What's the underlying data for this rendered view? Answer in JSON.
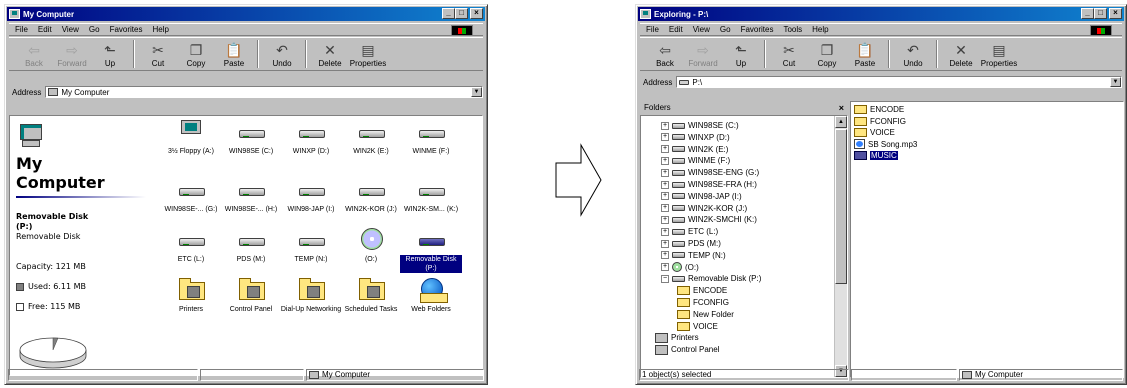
{
  "mycomputer": {
    "title": "My Computer",
    "menu": [
      "File",
      "Edit",
      "View",
      "Go",
      "Favorites",
      "Help"
    ],
    "toolbar": [
      {
        "label": "Back",
        "icon": "back-arrow-icon",
        "glyph": "⇦",
        "disabled": true
      },
      {
        "label": "Forward",
        "icon": "forward-arrow-icon",
        "glyph": "⇨",
        "disabled": true
      },
      {
        "label": "Up",
        "icon": "up-folder-icon",
        "glyph": "⬑",
        "disabled": false
      },
      {
        "label": "Cut",
        "icon": "scissors-icon",
        "glyph": "✂",
        "disabled": false
      },
      {
        "label": "Copy",
        "icon": "copy-icon",
        "glyph": "❐",
        "disabled": false
      },
      {
        "label": "Paste",
        "icon": "paste-icon",
        "glyph": "📋",
        "disabled": false
      },
      {
        "label": "Undo",
        "icon": "undo-icon",
        "glyph": "↶",
        "disabled": false
      },
      {
        "label": "Delete",
        "icon": "delete-x-icon",
        "glyph": "✕",
        "disabled": false
      },
      {
        "label": "Properties",
        "icon": "properties-icon",
        "glyph": "▤",
        "disabled": false
      }
    ],
    "address_label": "Address",
    "address_value": "My Computer",
    "heading": "My Computer",
    "selected_title": "Removable Disk (P:)",
    "selected_type": "Removable Disk",
    "capacity": "Capacity: 121 MB",
    "used": "Used: 6.11 MB",
    "free": "Free: 115 MB",
    "icons": [
      {
        "label": "3½ Floppy (A:)",
        "kind": "floppy"
      },
      {
        "label": "WIN98SE (C:)",
        "kind": "drive"
      },
      {
        "label": "WINXP (D:)",
        "kind": "drive"
      },
      {
        "label": "WIN2K (E:)",
        "kind": "drive"
      },
      {
        "label": "WINME (F:)",
        "kind": "drive"
      },
      {
        "label": "WIN98SE-... (G:)",
        "kind": "drive"
      },
      {
        "label": "WIN98SE-... (H:)",
        "kind": "drive"
      },
      {
        "label": "WIN98-JAP (I:)",
        "kind": "drive"
      },
      {
        "label": "WIN2K-KOR (J:)",
        "kind": "drive"
      },
      {
        "label": "WIN2K-SM... (K:)",
        "kind": "drive"
      },
      {
        "label": "ETC (L:)",
        "kind": "drive"
      },
      {
        "label": "PDS (M:)",
        "kind": "drive"
      },
      {
        "label": "TEMP (N:)",
        "kind": "drive"
      },
      {
        "label": "(O:)",
        "kind": "cd"
      },
      {
        "label": "Removable Disk (P:)",
        "kind": "removable",
        "selected": true
      },
      {
        "label": "Printers",
        "kind": "folder"
      },
      {
        "label": "Control Panel",
        "kind": "folder"
      },
      {
        "label": "Dial-Up Networking",
        "kind": "folder"
      },
      {
        "label": "Scheduled Tasks",
        "kind": "folder"
      },
      {
        "label": "Web Folders",
        "kind": "globe"
      }
    ],
    "status": "My Computer"
  },
  "explorer": {
    "title": "Exploring - P:\\",
    "menu": [
      "File",
      "Edit",
      "View",
      "Go",
      "Favorites",
      "Tools",
      "Help"
    ],
    "toolbar": [
      {
        "label": "Back",
        "icon": "back-arrow-icon",
        "glyph": "⇦",
        "disabled": false
      },
      {
        "label": "Forward",
        "icon": "forward-arrow-icon",
        "glyph": "⇨",
        "disabled": true
      },
      {
        "label": "Up",
        "icon": "up-folder-icon",
        "glyph": "⬑",
        "disabled": false
      },
      {
        "label": "Cut",
        "icon": "scissors-icon",
        "glyph": "✂",
        "disabled": false
      },
      {
        "label": "Copy",
        "icon": "copy-icon",
        "glyph": "❐",
        "disabled": false
      },
      {
        "label": "Paste",
        "icon": "paste-icon",
        "glyph": "📋",
        "disabled": false
      },
      {
        "label": "Undo",
        "icon": "undo-icon",
        "glyph": "↶",
        "disabled": false
      },
      {
        "label": "Delete",
        "icon": "delete-x-icon",
        "glyph": "✕",
        "disabled": false
      },
      {
        "label": "Properties",
        "icon": "properties-icon",
        "glyph": "▤",
        "disabled": false
      }
    ],
    "address_label": "Address",
    "address_value": "P:\\",
    "folders_label": "Folders",
    "tree": [
      {
        "label": "WIN98SE (C:)",
        "icon": "drive",
        "indent": 0,
        "pm": "+"
      },
      {
        "label": "WINXP (D:)",
        "icon": "drive",
        "indent": 0,
        "pm": "+"
      },
      {
        "label": "WIN2K (E:)",
        "icon": "drive",
        "indent": 0,
        "pm": "+"
      },
      {
        "label": "WINME (F:)",
        "icon": "drive",
        "indent": 0,
        "pm": "+"
      },
      {
        "label": "WIN98SE-ENG (G:)",
        "icon": "drive",
        "indent": 0,
        "pm": "+"
      },
      {
        "label": "WIN98SE-FRA (H:)",
        "icon": "drive",
        "indent": 0,
        "pm": "+"
      },
      {
        "label": "WIN98-JAP (I:)",
        "icon": "drive",
        "indent": 0,
        "pm": "+"
      },
      {
        "label": "WIN2K-KOR (J:)",
        "icon": "drive",
        "indent": 0,
        "pm": "+"
      },
      {
        "label": "WIN2K-SMCHI (K:)",
        "icon": "drive",
        "indent": 0,
        "pm": "+"
      },
      {
        "label": "ETC (L:)",
        "icon": "drive",
        "indent": 0,
        "pm": "+"
      },
      {
        "label": "PDS (M:)",
        "icon": "drive",
        "indent": 0,
        "pm": "+"
      },
      {
        "label": "TEMP (N:)",
        "icon": "drive",
        "indent": 0,
        "pm": "+"
      },
      {
        "label": "(O:)",
        "icon": "cd",
        "indent": 0,
        "pm": "+"
      },
      {
        "label": "Removable Disk (P:)",
        "icon": "drive",
        "indent": 0,
        "pm": "−"
      },
      {
        "label": "ENCODE",
        "icon": "folder",
        "indent": 1,
        "pm": ""
      },
      {
        "label": "FCONFIG",
        "icon": "folder",
        "indent": 1,
        "pm": ""
      },
      {
        "label": "New Folder",
        "icon": "folder",
        "indent": 1,
        "pm": ""
      },
      {
        "label": "VOICE",
        "icon": "folder",
        "indent": 1,
        "pm": ""
      },
      {
        "label": "Printers",
        "icon": "special",
        "indent": -1,
        "pm": ""
      },
      {
        "label": "Control Panel",
        "icon": "special",
        "indent": -1,
        "pm": ""
      }
    ],
    "files": [
      {
        "label": "ENCODE",
        "icon": "folder",
        "selected": false
      },
      {
        "label": "FCONFIG",
        "icon": "folder",
        "selected": false
      },
      {
        "label": "VOICE",
        "icon": "folder",
        "selected": false
      },
      {
        "label": "SB Song.mp3",
        "icon": "mp3",
        "selected": false
      },
      {
        "label": "MUSIC",
        "icon": "folder",
        "selected": true
      }
    ],
    "status_left": "1 object(s) selected",
    "status_right": "My Computer"
  }
}
